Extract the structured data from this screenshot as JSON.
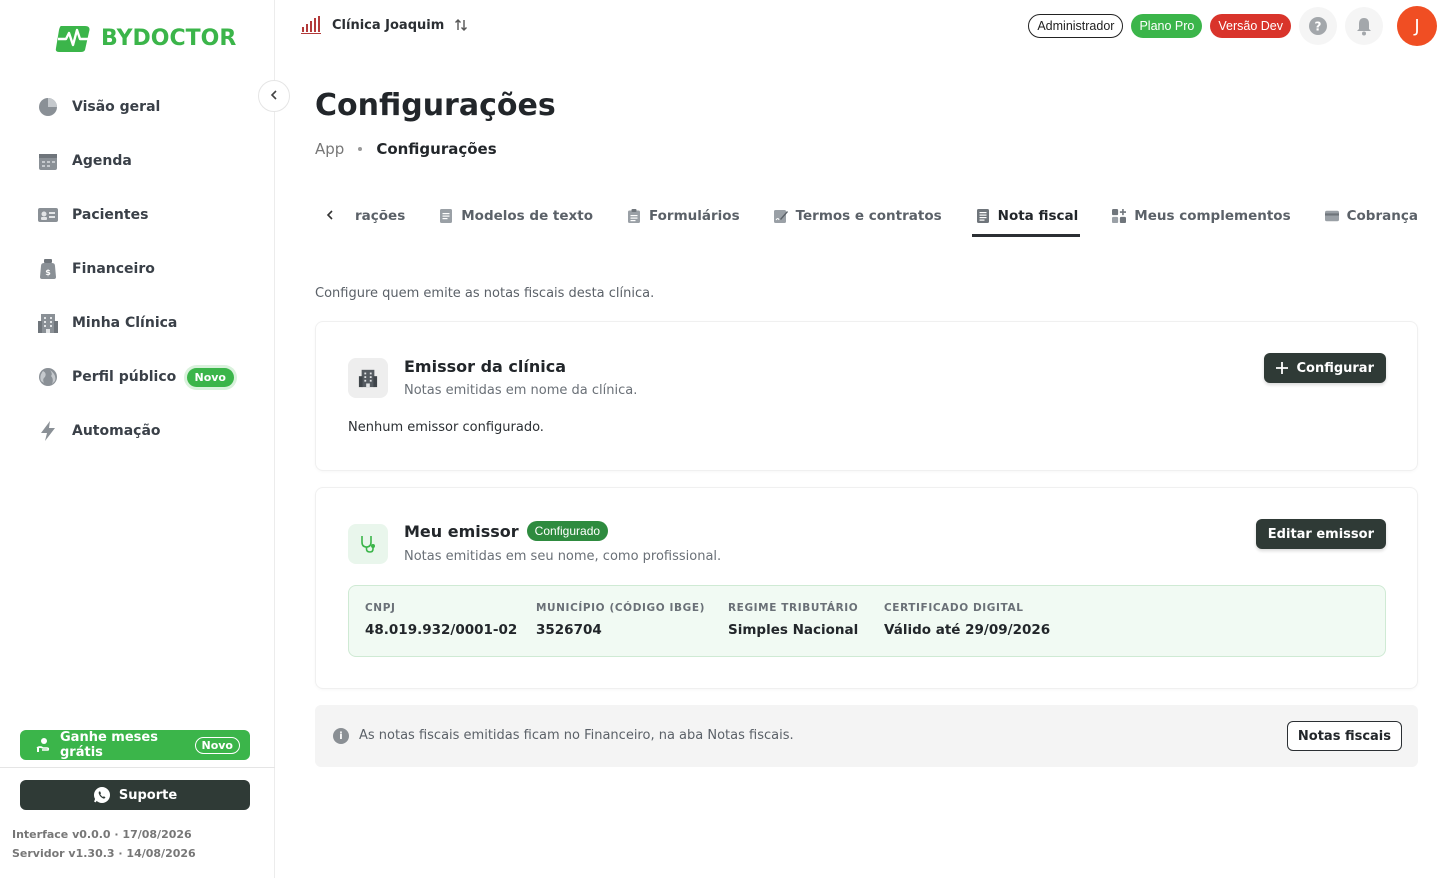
{
  "brand": {
    "name": "BYDOCTOR",
    "color": "#3bb54a"
  },
  "sidebar": {
    "items": [
      {
        "label": "Visão geral",
        "icon": "pie-chart-icon"
      },
      {
        "label": "Agenda",
        "icon": "calendar-icon"
      },
      {
        "label": "Pacientes",
        "icon": "id-card-icon"
      },
      {
        "label": "Financeiro",
        "icon": "money-bag-icon"
      },
      {
        "label": "Minha Clínica",
        "icon": "building-icon"
      },
      {
        "label": "Perfil público",
        "icon": "globe-icon",
        "badge": "Novo"
      },
      {
        "label": "Automação",
        "icon": "lightning-icon"
      }
    ],
    "promo": {
      "label": "Ganhe meses grátis",
      "badge": "Novo"
    },
    "support_label": "Suporte",
    "interface_version": "Interface v0.0.0 · 17/08/2026",
    "server_version": "Servidor v1.30.3 · 14/08/2026"
  },
  "header": {
    "clinic_name": "Clínica Joaquim",
    "role": "Administrador",
    "plan": "Plano Pro",
    "version_tag": "Versão Dev",
    "avatar_initial": "J"
  },
  "page": {
    "title": "Configurações",
    "breadcrumb": [
      "App",
      "Configurações"
    ]
  },
  "tabs": [
    {
      "label": "rações",
      "icon": "",
      "active": false
    },
    {
      "label": "Modelos de texto",
      "icon": "document-icon",
      "active": false
    },
    {
      "label": "Formulários",
      "icon": "clipboard-icon",
      "active": false
    },
    {
      "label": "Termos e contratos",
      "icon": "signature-icon",
      "active": false
    },
    {
      "label": "Nota fiscal",
      "icon": "receipt-icon",
      "active": true
    },
    {
      "label": "Meus complementos",
      "icon": "apps-add-icon",
      "active": false
    },
    {
      "label": "Cobrança",
      "icon": "credit-card-icon",
      "active": false
    }
  ],
  "intro": "Configure quem emite as notas fiscais desta clínica.",
  "clinic_issuer": {
    "title": "Emissor da clínica",
    "subtitle": "Notas emitidas em nome da clínica.",
    "button": "Configurar",
    "empty": "Nenhum emissor configurado."
  },
  "my_issuer": {
    "title": "Meu emissor",
    "status": "Configurado",
    "subtitle": "Notas emitidas em seu nome, como profissional.",
    "button": "Editar emissor",
    "fields": [
      {
        "label": "CNPJ",
        "value": "48.019.932/0001-02"
      },
      {
        "label": "MUNICÍPIO (CÓDIGO IBGE)",
        "value": "3526704"
      },
      {
        "label": "REGIME TRIBUTÁRIO",
        "value": "Simples Nacional"
      },
      {
        "label": "CERTIFICADO DIGITAL",
        "value": "Válido até 29/09/2026"
      }
    ]
  },
  "note": {
    "text": "As notas fiscais emitidas ficam no Financeiro, na aba Notas fiscais.",
    "button": "Notas fiscais"
  }
}
